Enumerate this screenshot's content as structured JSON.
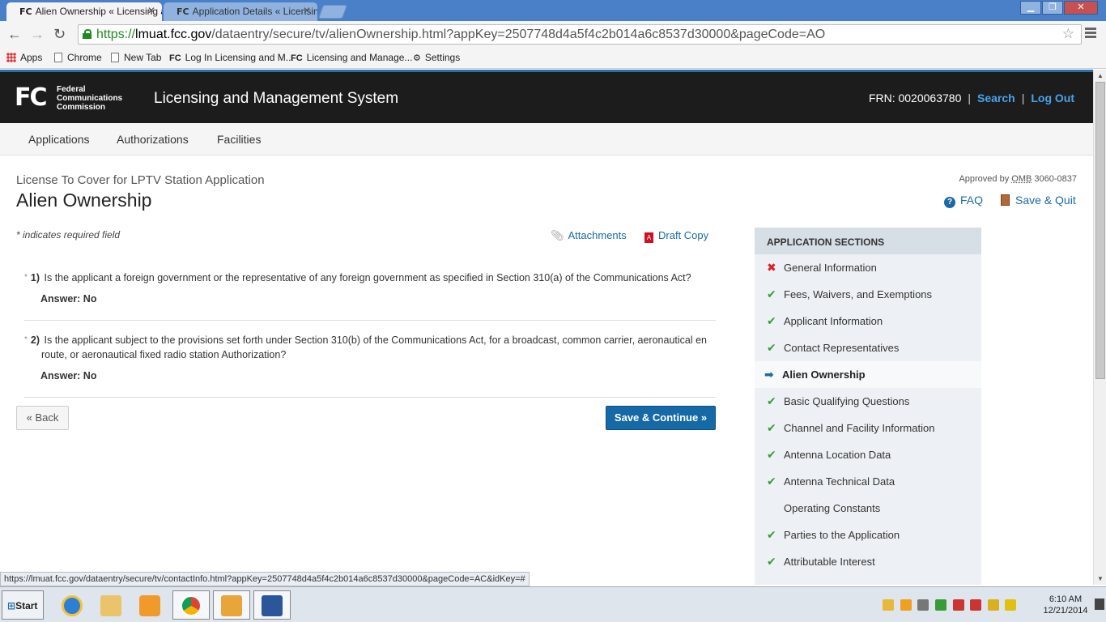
{
  "browser": {
    "tabs": [
      {
        "favicon": "FC",
        "label": "Alien Ownership « Licensing a"
      },
      {
        "favicon": "FC",
        "label": "Application Details « Licensin"
      }
    ],
    "url_scheme": "https://",
    "url_host": "lmuat.fcc.gov",
    "url_path": "/dataentry/secure/tv/alienOwnership.html?appKey=2507748d4a5f4c2b014a6c8537d30000&pageCode=AO",
    "bookmarks": [
      "Apps",
      "Chrome",
      "New Tab",
      "Log In Licensing and M...",
      "Licensing and Manage...",
      "Settings"
    ],
    "status_url": "https://lmuat.fcc.gov/dataentry/secure/tv/contactInfo.html?appKey=2507748d4a5f4c2b014a6c8537d30000&pageCode=AC&idKey=#"
  },
  "header": {
    "logo": "FC",
    "agency_lines": [
      "Federal",
      "Communications",
      "Commission"
    ],
    "system_title": "Licensing and Management System",
    "frn": "FRN: 0020063780",
    "sep": "|",
    "search": "Search",
    "logout": "Log Out"
  },
  "nav": [
    "Applications",
    "Authorizations",
    "Facilities"
  ],
  "page": {
    "app_type": "License To Cover for LPTV Station Application",
    "title": "Alien Ownership",
    "approved_by": "Approved by",
    "omb": "OMB",
    "omb_number": "3060-0837",
    "faq": "FAQ",
    "save_quit": "Save & Quit",
    "required_note": "* indicates required field",
    "attachments": "Attachments",
    "draft_copy": "Draft Copy"
  },
  "questions": [
    {
      "num": "1)",
      "text": "Is the applicant a foreign government or the representative of any foreign government as specified in Section 310(a) of the Communications Act?",
      "answer": "Answer: No"
    },
    {
      "num": "2)",
      "text": "Is the applicant subject to the provisions set forth under Section 310(b) of the Communications Act, for a broadcast, common carrier, aeronautical en route, or aeronautical fixed radio station Authorization?",
      "answer": "Answer: No"
    }
  ],
  "buttons": {
    "back": "« Back",
    "save_continue": "Save & Continue »"
  },
  "sections": {
    "heading": "APPLICATION SECTIONS",
    "items": [
      {
        "label": "General Information",
        "status": "error"
      },
      {
        "label": "Fees, Waivers, and Exemptions",
        "status": "complete"
      },
      {
        "label": "Applicant Information",
        "status": "complete"
      },
      {
        "label": "Contact Representatives",
        "status": "complete"
      },
      {
        "label": "Alien Ownership",
        "status": "current"
      },
      {
        "label": "Basic Qualifying Questions",
        "status": "complete"
      },
      {
        "label": "Channel and Facility Information",
        "status": "complete"
      },
      {
        "label": "Antenna Location Data",
        "status": "complete"
      },
      {
        "label": "Antenna Technical Data",
        "status": "complete"
      },
      {
        "label": "Operating Constants",
        "status": "none"
      },
      {
        "label": "Parties to the Application",
        "status": "complete"
      },
      {
        "label": "Attributable Interest",
        "status": "complete"
      }
    ]
  },
  "taskbar": {
    "start": "Start",
    "time": "6:10 AM",
    "date": "12/21/2014"
  },
  "colors": {
    "accent": "#1569a6",
    "check": "#3c9a3c",
    "error": "#d22222",
    "header_bg": "#1c1c1c"
  }
}
